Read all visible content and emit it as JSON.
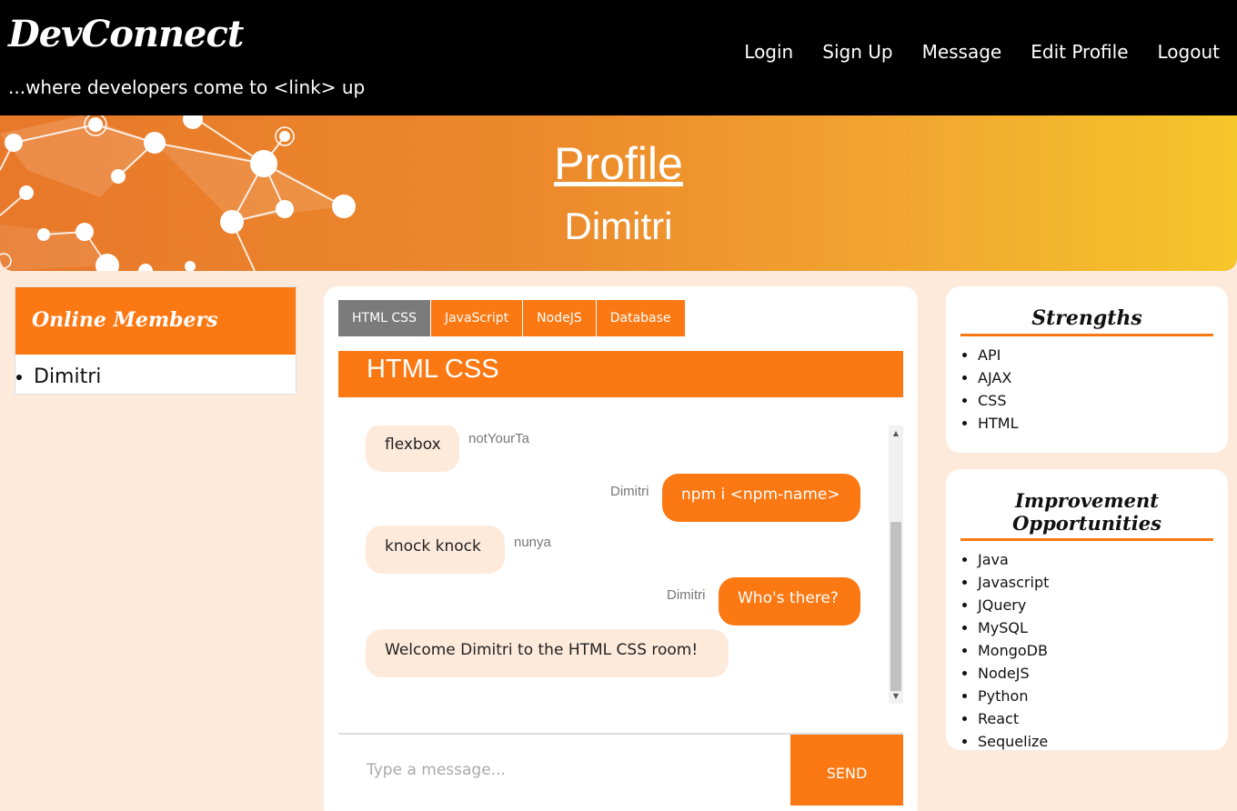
{
  "header": {
    "brand": "DevConnect",
    "tagline": "...where developers come to <link> up",
    "nav": [
      "Login",
      "Sign Up",
      "Message",
      "Edit Profile",
      "Logout"
    ]
  },
  "banner": {
    "title": "Profile",
    "name": "Dimitri"
  },
  "members": {
    "title": "Online Members",
    "items": [
      "Dimitri"
    ]
  },
  "chat": {
    "tabs": [
      "HTML CSS",
      "JavaScript",
      "NodeJS",
      "Database"
    ],
    "active_tab": "HTML CSS",
    "room_title": "HTML CSS",
    "messages": [
      {
        "text": "flexbox",
        "sender": "notYourTa",
        "direction": "in"
      },
      {
        "text": "npm i <npm-name>",
        "sender": "Dimitri",
        "direction": "out"
      },
      {
        "text": "knock knock",
        "sender": "nunya",
        "direction": "in"
      },
      {
        "text": "Who's there?",
        "sender": "Dimitri",
        "direction": "out"
      },
      {
        "text": "Welcome Dimitri to the HTML CSS room!",
        "sender": "",
        "direction": "in"
      }
    ],
    "input_placeholder": "Type a message...",
    "send_label": "SEND"
  },
  "strengths": {
    "title": "Strengths",
    "items": [
      "API",
      "AJAX",
      "CSS",
      "HTML"
    ]
  },
  "improvements": {
    "title": "Improvement Opportunities",
    "items": [
      "Java",
      "Javascript",
      "JQuery",
      "MySQL",
      "MongoDB",
      "NodeJS",
      "Python",
      "React",
      "Sequelize"
    ]
  },
  "colors": {
    "accent": "#fb7812",
    "background": "#fdeadb",
    "header": "#000000",
    "tab_active": "#7b7b7b"
  },
  "icons": {
    "scroll_up": "arrow-up-icon",
    "scroll_down": "arrow-down-icon"
  }
}
